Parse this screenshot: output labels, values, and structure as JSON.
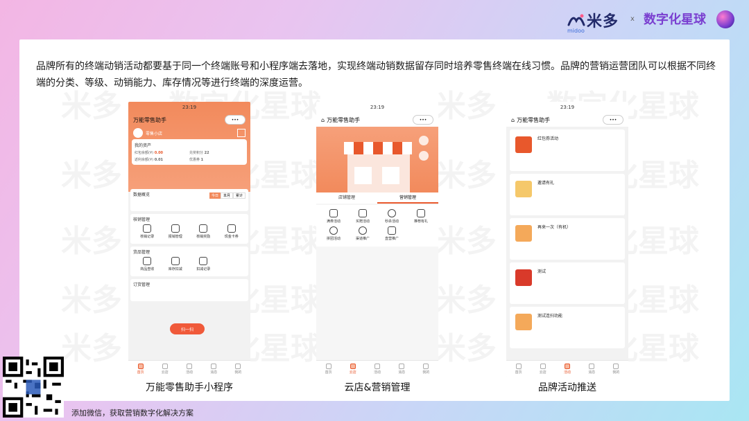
{
  "header": {
    "midoo_text": "米多",
    "midoo_sub": "midoo",
    "separator": "x",
    "star_text": "数字化星球"
  },
  "intro": "品牌所有的终端动销活动都要基于同一个终端账号和小程序端去落地，实现终端动销数据留存同时培养零售终端在线习惯。品牌的营销运营团队可以根据不同终端的分类、等级、动销能力、库存情况等进行终端的深度运营。",
  "watermarks": [
    "米多",
    "数字化星球"
  ],
  "phones": [
    {
      "caption": "万能零售助手小程序",
      "time": "23:19",
      "title": "万能零售助手",
      "shop_name": "零售小店",
      "assets_label": "我的资产",
      "assets": [
        {
          "label": "红包余额(¥)",
          "value": "0.00"
        },
        {
          "label": "兑奖积分",
          "value": "22"
        },
        {
          "label": "返利余额(¥)",
          "value": "0.01"
        },
        {
          "label": "优惠券",
          "value": "1"
        }
      ],
      "overview_label": "数据概览",
      "overview_tabs": [
        "今日",
        "本月",
        "累计"
      ],
      "sections": [
        {
          "title": "核销管理",
          "items": [
            "核销记录",
            "报销管理",
            "核销奖励",
            "现金卡券"
          ]
        },
        {
          "title": "货品管理",
          "items": [
            "商品查收",
            "库存扣减",
            "扣减记录"
          ]
        },
        {
          "title": "订货管理",
          "items": [
            ""
          ]
        }
      ],
      "promo": "扫一扫",
      "tabs": [
        "首页",
        "云店",
        "活动",
        "消息",
        "我的"
      ],
      "active_tab": 0
    },
    {
      "caption": "云店&营销管理",
      "time": "23:19",
      "title": "万能零售助手",
      "store_tabs": [
        "店铺管理",
        "营销管理"
      ],
      "items": [
        "满券活动",
        "买赠活动",
        "秒杀活动",
        "推荐有礼",
        "拼团活动",
        "渠道推广",
        "直营推广"
      ],
      "tabs": [
        "首页",
        "云店",
        "活动",
        "消息",
        "我的"
      ],
      "active_tab": 1
    },
    {
      "caption": "品牌活动推送",
      "time": "23:19",
      "title": "万能零售助手",
      "activities": [
        {
          "name": "红包券活动"
        },
        {
          "name": "邀请有礼"
        },
        {
          "name": "再来一次（有机）"
        },
        {
          "name": "测试"
        },
        {
          "name": "测试连扫功能"
        }
      ],
      "tabs": [
        "首页",
        "云店",
        "活动",
        "消息",
        "我的"
      ],
      "active_tab": 2
    }
  ],
  "footer": {
    "text": "添加微信，获取营销数字化解决方案"
  },
  "colors": {
    "accent": "#f28a5c",
    "brand_blue": "#222a6a",
    "star_purple": "#7a3fd0"
  }
}
